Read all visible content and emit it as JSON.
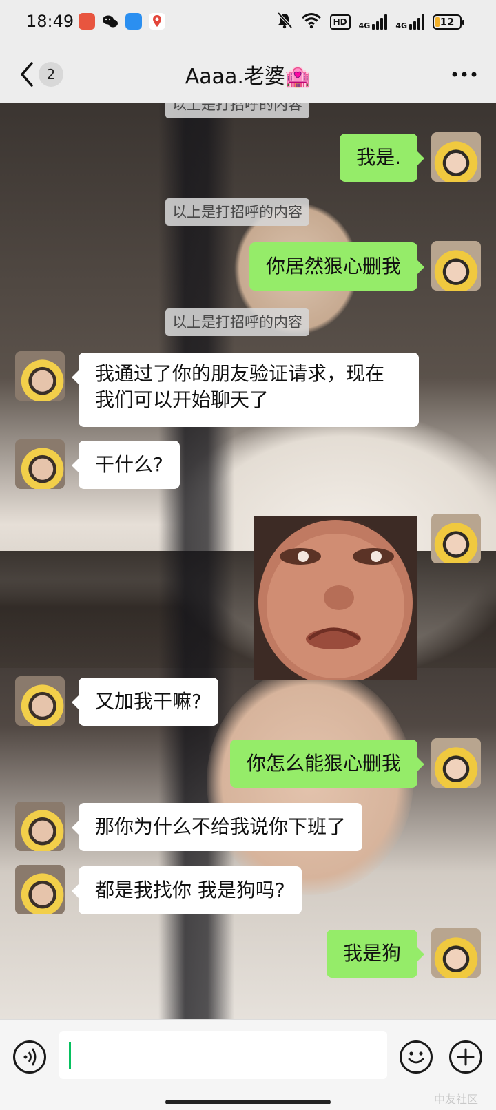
{
  "status_bar": {
    "time": "18:49",
    "battery": "12",
    "network_hd": "HD",
    "network_1": "4G",
    "network_2": "4G"
  },
  "header": {
    "unread_count": "2",
    "title": "Aaaa.老婆🏩"
  },
  "messages": [
    {
      "kind": "system",
      "text": "以上是打招呼的内容"
    },
    {
      "kind": "out",
      "text": "我是."
    },
    {
      "kind": "system",
      "text": "以上是打招呼的内容"
    },
    {
      "kind": "out",
      "text": "你居然狠心删我"
    },
    {
      "kind": "system",
      "text": "以上是打招呼的内容"
    },
    {
      "kind": "in",
      "text": "我通过了你的朋友验证请求，现在我们可以开始聊天了"
    },
    {
      "kind": "in",
      "text": "干什么?"
    },
    {
      "kind": "out",
      "text": "[sticker]"
    },
    {
      "kind": "in",
      "text": "又加我干嘛?"
    },
    {
      "kind": "out",
      "text": "你怎么能狠心删我"
    },
    {
      "kind": "in",
      "text": "那你为什么不给我说你下班了"
    },
    {
      "kind": "in",
      "text": "都是我找你 我是狗吗?"
    },
    {
      "kind": "out",
      "text": "我是狗"
    }
  ],
  "input": {
    "value": ""
  },
  "watermark": "中友社区",
  "colors": {
    "outgoing_bubble": "#95ec69",
    "incoming_bubble": "#ffffff",
    "caret": "#07c160",
    "battery_fill": "#f2b12b"
  }
}
